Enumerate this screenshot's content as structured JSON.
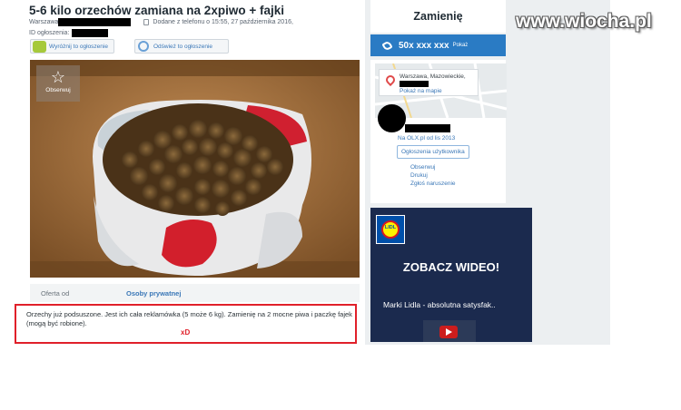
{
  "watermark": "www.wiocha.pl",
  "ad": {
    "title": "5-6 kilo orzechów zamiana na 2xpiwo + fajki",
    "location": "Warszawa",
    "added": "Dodane z telefonu o 15:55, 27 października 2016,",
    "id_label": "ID ogłoszenia:",
    "btn_highlight": "Wyróżnij to ogłoszenie",
    "btn_refresh": "Odśwież to ogłoszenie",
    "follow": "Obserwuj",
    "offer_label": "Oferta od",
    "offer_value": "Osoby prywatnej",
    "description": "Orzechy już podsuszone. Jest ich cała reklamówka (5 może 6 kg). Zamienię na 2 mocne piwa i paczkę fajek (mogą być robione).",
    "annotation": "xD"
  },
  "sidebar": {
    "price": "Zamienię",
    "phone": "50x xxx xxx",
    "phone_show": "Pokaż",
    "map_location": "Warszawa, Mazowieckie,",
    "map_link": "Pokaż na mapie",
    "member_since": "Na OLX.pl od lis 2013",
    "user_ads_btn": "Ogłoszenia użytkownika",
    "links": [
      "Obserwuj",
      "Drukuj",
      "Zgłoś naruszenie"
    ]
  },
  "banner": {
    "brand": "LIDL",
    "headline": "ZOBACZ WIDEO!",
    "caption": "Marki Lidla - absolutna satysfak.."
  },
  "colors": {
    "accent_blue": "#2a7bc4",
    "highlight_red": "#e0202a"
  }
}
